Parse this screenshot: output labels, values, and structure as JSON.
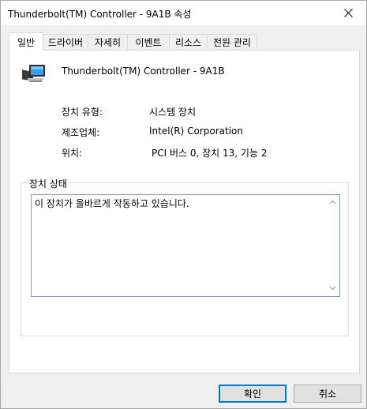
{
  "window": {
    "title": "Thunderbolt(TM) Controller - 9A1B 속성",
    "close_icon": "close-icon"
  },
  "tabs": [
    {
      "label": "일반",
      "active": true
    },
    {
      "label": "드라이버",
      "active": false
    },
    {
      "label": "자세히",
      "active": false
    },
    {
      "label": "이벤트",
      "active": false
    },
    {
      "label": "리소스",
      "active": false
    },
    {
      "label": "전원 관리",
      "active": false
    }
  ],
  "general": {
    "device_icon": "monitor-device-icon",
    "device_name": "Thunderbolt(TM) Controller - 9A1B",
    "properties": [
      {
        "label": "장치 유형:",
        "value": "시스템 장치"
      },
      {
        "label": "제조업체:",
        "value": "Intel(R) Corporation"
      },
      {
        "label": "위치:",
        "value": "PCI 버스 0, 장치 13, 기능 2"
      }
    ],
    "status_group_title": "장치 상태",
    "status_text": "이 장치가 올바르게 작동하고 있습니다."
  },
  "buttons": {
    "ok": "확인",
    "cancel": "취소"
  },
  "colors": {
    "accent": "#0078d7",
    "status_border": "#7a9cc5"
  }
}
